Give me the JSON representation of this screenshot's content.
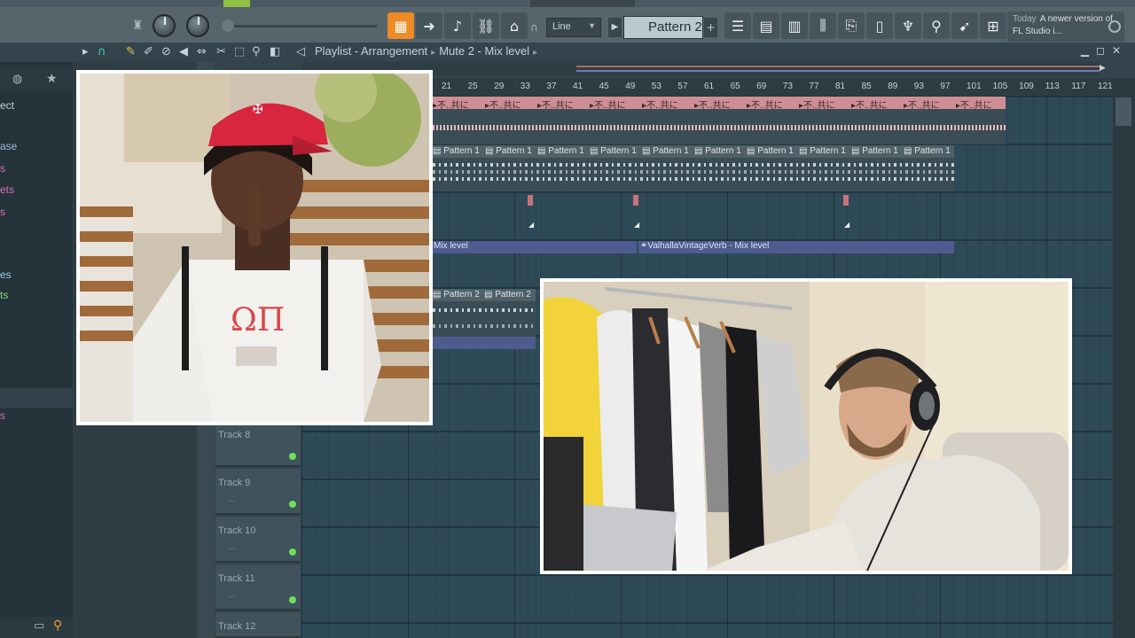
{
  "toolbar": {
    "pattern_label": "Pattern 2",
    "snap_label": "Line",
    "hint_today": "Today",
    "hint_text": "A newer version of FL Studio i..."
  },
  "playlist": {
    "title": "Playlist - Arrangement",
    "breadcrumb": "Mute 2 - Mix level"
  },
  "browser": {
    "items": [
      {
        "label": "ect",
        "color": "#c6d1d5"
      },
      {
        "label": "ase",
        "color": "#9ab6e0"
      },
      {
        "label": "s",
        "color": "#d870b8"
      },
      {
        "label": "ets",
        "color": "#d870b8"
      },
      {
        "label": "s",
        "color": "#d870b8"
      },
      {
        "label": "es",
        "color": "#9ad0e8"
      },
      {
        "label": "ts",
        "color": "#7fd97a"
      },
      {
        "label": "s",
        "color": "#d870b8"
      }
    ]
  },
  "timeline": {
    "ticks": [
      "21",
      "25",
      "29",
      "33",
      "37",
      "41",
      "45",
      "49",
      "53",
      "57",
      "61",
      "65",
      "69",
      "73",
      "77",
      "81",
      "85",
      "89",
      "93",
      "97",
      "101",
      "105",
      "109",
      "113",
      "117",
      "121"
    ]
  },
  "tracks": [
    {
      "name": "Track 8"
    },
    {
      "name": "Track 9"
    },
    {
      "name": "Track 10"
    },
    {
      "name": "Track 11"
    },
    {
      "name": "Track 12"
    }
  ],
  "clips": {
    "audio_label": "不..共に",
    "pattern1_label": "Pattern 1",
    "pattern2_label": "Pattern 2",
    "auto1_label": "Mix level",
    "auto2_label": "ValhallaVintageVerb - Mix level"
  },
  "photos": {
    "left_alt": "Photo of a rapper in a red cap making a shush gesture",
    "right_alt": "Photo of a producer wearing headphones at a laptop"
  }
}
